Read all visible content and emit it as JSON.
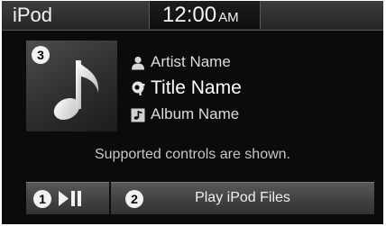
{
  "header": {
    "title": "iPod",
    "clock": {
      "time": "12:00",
      "ampm": "AM"
    }
  },
  "album_art": {
    "icon": "music-note-icon",
    "callout": "3"
  },
  "track": {
    "artist": "Artist Name",
    "title": "Title Name",
    "album": "Album Name"
  },
  "message": "Supported controls are shown.",
  "buttons": {
    "play_pause": {
      "callout": "1",
      "icon": "play-pause-icon"
    },
    "play_files": {
      "callout": "2",
      "label": "Play iPod Files"
    }
  }
}
